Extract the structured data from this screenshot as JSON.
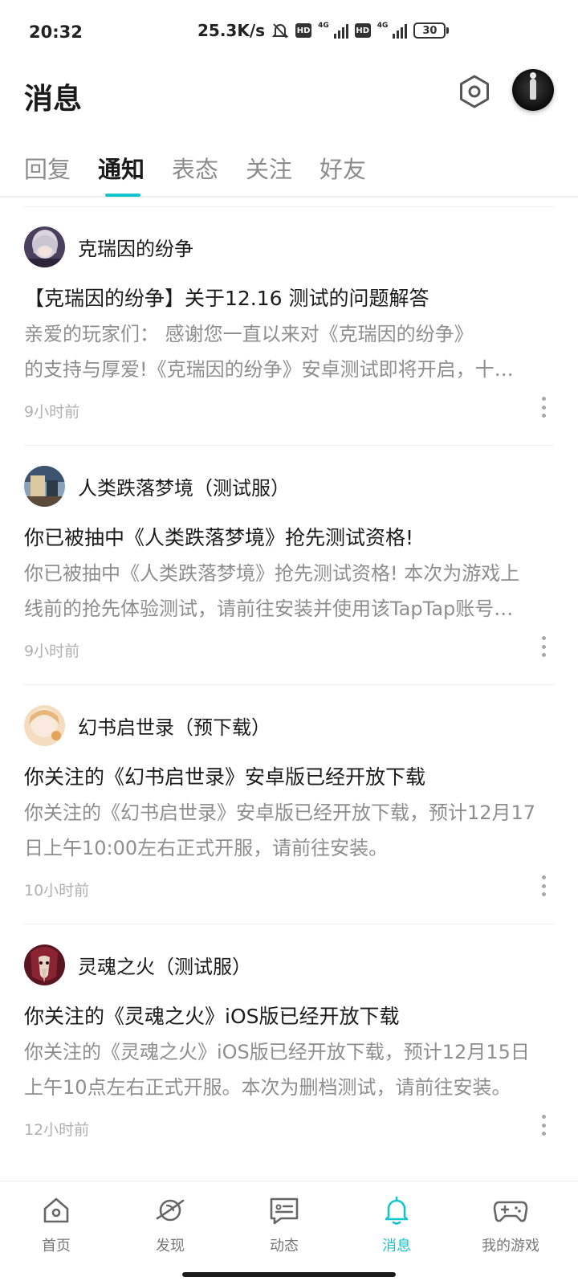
{
  "status_bar": {
    "time": "20:32",
    "speed": "25.3K/s",
    "hd_badge": "HD",
    "network": "4G",
    "battery": "30"
  },
  "header": {
    "title": "消息",
    "settings_icon": "settings-hexagon-icon",
    "avatar_icon": "user-avatar"
  },
  "tabs": [
    {
      "label": "回复"
    },
    {
      "label": "通知",
      "active": true
    },
    {
      "label": "表态"
    },
    {
      "label": "关注"
    },
    {
      "label": "好友"
    }
  ],
  "notifications": [
    {
      "source": "克瑞因的纷争",
      "title": "【克瑞因的纷争】关于12.16 测试的问题解答",
      "body_line1": "亲爱的玩家们：          感谢您一直以来对《克瑞因的纷争》",
      "body_line2": "的支持与厚爱!《克瑞因的纷争》安卓测试即将开启，十…",
      "time": "9小时前",
      "avatar_color": "#6b5a7a"
    },
    {
      "source": "人类跌落梦境（测试服）",
      "title": "你已被抽中《人类跌落梦境》抢先测试资格!",
      "body_line1": "你已被抽中《人类跌落梦境》抢先测试资格! 本次为游戏上",
      "body_line2": "线前的抢先体验测试，请前往安装并使用该TapTap账号…",
      "time": "9小时前",
      "avatar_color": "#4e6a86"
    },
    {
      "source": "幻书启世录（预下载）",
      "title": "你关注的《幻书启世录》安卓版已经开放下载",
      "body_line1": "你关注的《幻书启世录》安卓版已经开放下载，预计12月17",
      "body_line2": "日上午10:00左右正式开服，请前往安装。",
      "time": "10小时前",
      "avatar_color": "#e8c49a"
    },
    {
      "source": "灵魂之火（测试服）",
      "title": "你关注的《灵魂之火》iOS版已经开放下载",
      "body_line1": "你关注的《灵魂之火》iOS版已经开放下载，预计12月15日",
      "body_line2": "上午10点左右正式开服。本次为删档测试，请前往安装。",
      "time": "12小时前",
      "avatar_color": "#7a1f2a"
    }
  ],
  "bottom_nav": [
    {
      "label": "首页",
      "icon": "home-icon"
    },
    {
      "label": "发现",
      "icon": "planet-icon"
    },
    {
      "label": "动态",
      "icon": "chat-icon"
    },
    {
      "label": "消息",
      "icon": "bell-icon",
      "active": true
    },
    {
      "label": "我的游戏",
      "icon": "gamepad-icon"
    }
  ],
  "accent_color": "#15c5ce"
}
